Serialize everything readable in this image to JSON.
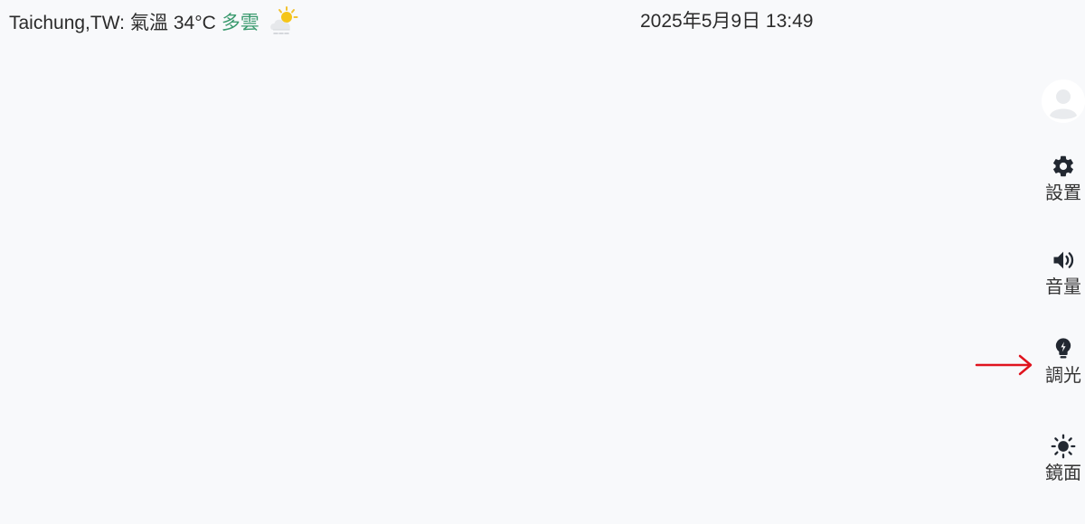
{
  "weather": {
    "location": "Taichung,TW:",
    "temp_label": "氣溫 34°C",
    "condition": "多雲",
    "icon": "partly-cloudy-icon"
  },
  "datetime": "2025年5月9日 13:49",
  "sidebar": {
    "avatar_icon": "user-avatar-icon",
    "items": [
      {
        "label": "設置",
        "icon": "gear-icon"
      },
      {
        "label": "音量",
        "icon": "speaker-icon"
      },
      {
        "label": "調光",
        "icon": "lightbulb-icon"
      },
      {
        "label": "鏡面",
        "icon": "sun-icon"
      }
    ]
  },
  "colors": {
    "background": "#f8f9fb",
    "condition_text": "#3a9a6e",
    "icon": "#222831",
    "arrow": "#e0141e"
  }
}
